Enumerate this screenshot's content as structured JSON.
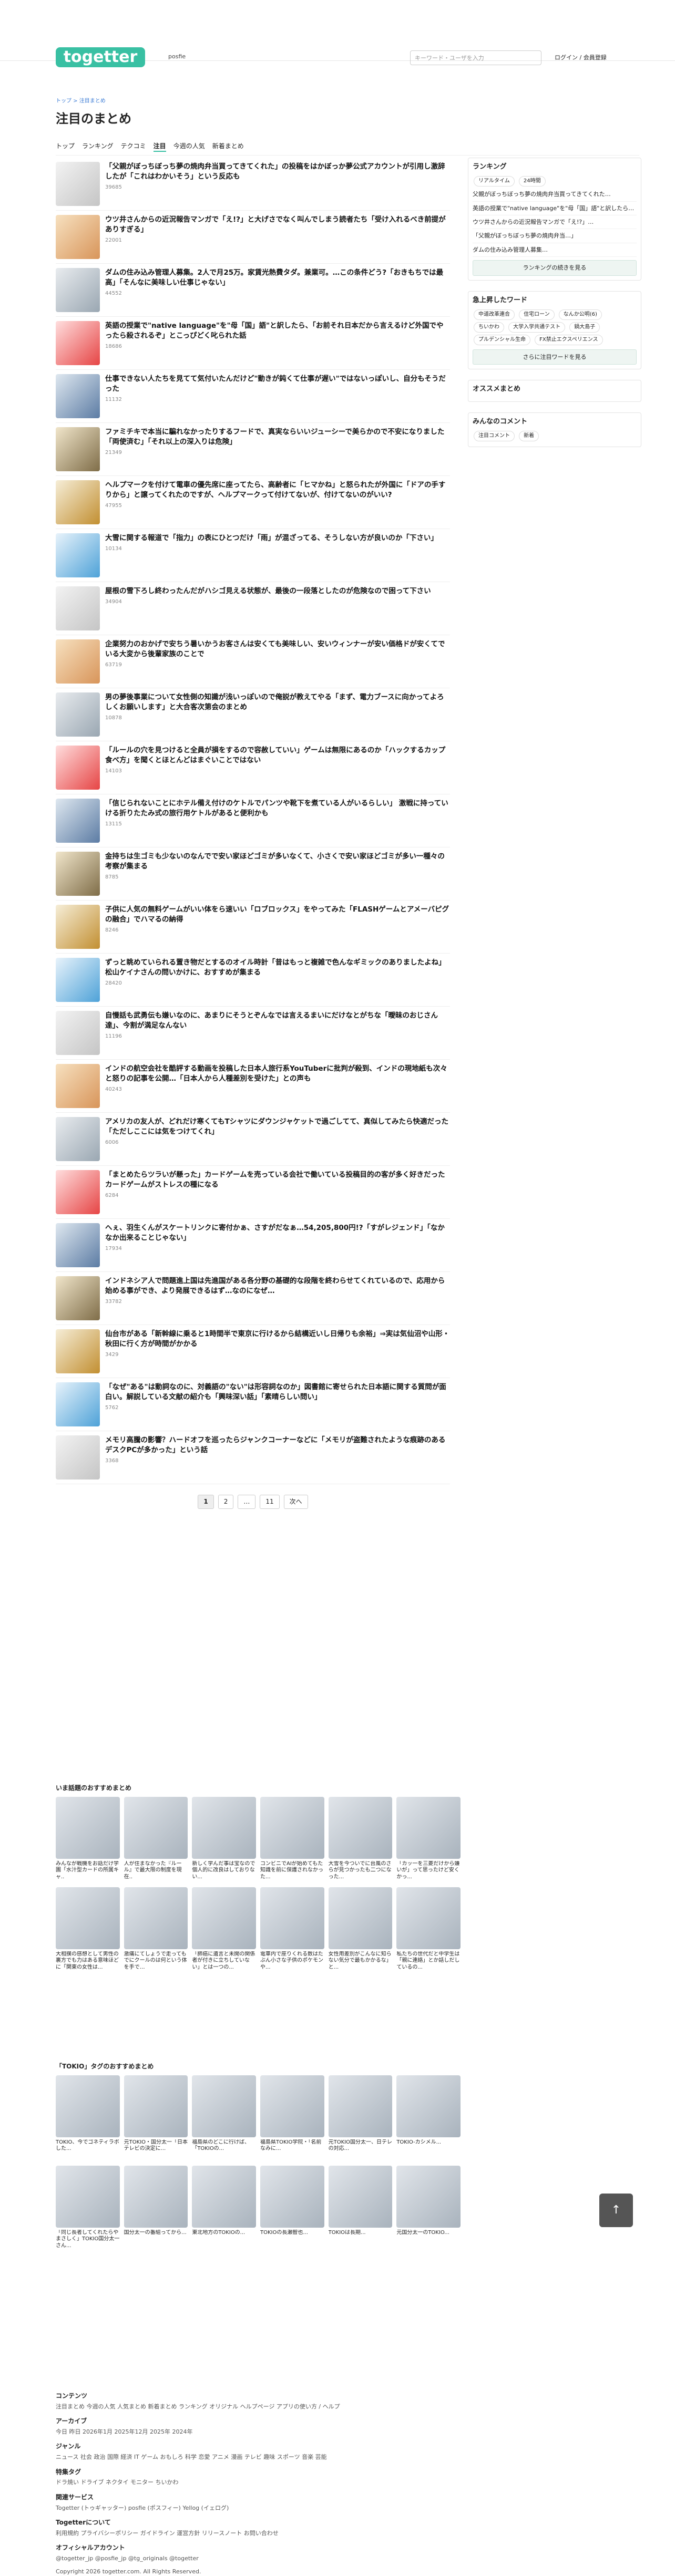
{
  "header": {
    "logo": "togetter",
    "sub": "posfie",
    "search_placeholder": "キーワード・ユーザを入力",
    "login": "ログイン / 会員登録"
  },
  "breadcrumb": "トップ > 注目まとめ",
  "page_title": "注目のまとめ",
  "tabs": [
    "トップ",
    "ランキング",
    "テクコミ",
    "注目",
    "今週の人気",
    "新着まとめ"
  ],
  "items": [
    {
      "t": "「父親がぼっちぼっち夢の焼肉弁当買ってきてくれた」の投稿をはかぼっか夢公式アカウントが引用し激辞したが「これはわかいそう」という反応も",
      "n": "39685"
    },
    {
      "t": "ウツ井さんからの近況報告マンガで「え!?」と大げさでなく叫んでしまう読者たち「受け入れるべき前提がありすぎる」",
      "n": "22001"
    },
    {
      "t": "ダムの住み込み管理人募集。2人で月25万。家賃光熱費タダ。兼業可。…この条件どう?「おきもちでは最高」「そんなに美味しい仕事じゃない」",
      "n": "44552"
    },
    {
      "t": "英語の授業で\"native language\"を\"母「国」語\"と訳したら、「お前それ日本だから言えるけど外国でやったら殺されるぞ」とこっぴどく叱られた話",
      "n": "18686"
    },
    {
      "t": "仕事できない人たちを見てて気付いたんだけど\"動きが鈍くて仕事が遅い\"ではないっぽいし、自分もそうだった",
      "n": "11132"
    },
    {
      "t": "ファミチキで本当に騙れなかったりするフードで、真実ならいいジューシーで美らかので不安になりました「両使済む」「それ以上の深入りは危険」",
      "n": "21349"
    },
    {
      "t": "ヘルプマークを付けて電車の優先席に座ってたら、高齢者に「ヒマかね」と怒られたが外国に「ドアの手すりから」と譲ってくれたのですが、ヘルプマークって付けてないが、付けてないのがいい?",
      "n": "47955"
    },
    {
      "t": "大雪に関する報道で「指力」の表にひとつだけ「雨」が混ざってる、そうしない方が良いのか「下さい」",
      "n": "10134"
    },
    {
      "t": "屋根の雪下ろし終わったんだがハシゴ見える状態が、最後の一段落としたのが危険なので困って下さい",
      "n": "34904"
    },
    {
      "t": "企業努力のおかげで安ちう暑いかうお客さんは安くても美味しい、安いウィンナーが安い価格ドが安くてでいる大変から後輩家族のことで",
      "n": "63719"
    },
    {
      "t": "男の夢後事業について女性側の知識が浅いっぽいので俺説が教えてやる「まず、電力ブースに向かってよろしくお願いします」と大合客次第会のまとめ",
      "n": "10878"
    },
    {
      "t": "「ルールの穴を見つけると全員が損をするので容赦していい」ゲームは無限にあるのか「ハックするカップ食べ方」を聞くとほとんどはまぐいことではない",
      "n": "14103"
    },
    {
      "t": "「信じられないことにホテル備え付けのケトルでパンツや靴下を煮ている人がいるらしい」 激戦に持っていける折りたたみ式の旅行用ケトルがあると便利かも",
      "n": "13115"
    },
    {
      "t": "金持ちは生ゴミも少ないのなんでで安い家ほどゴミが多いなくて、小さくで安い家ほどゴミが多い一種々の考察が集まる",
      "n": "8785"
    },
    {
      "t": "子供に人気の無料ゲームがいい体をら速いい「ロブロックス」をやってみた「FLASHゲームとアメーバピグの融合」でハマるの納得",
      "n": "8246"
    },
    {
      "t": "ずっと眺めていられる置き物だとするのオイル時計「昔はもっと複雑で色んなギミックのありましたよね」松山ケイナさんの問いかけに、おすすめが集まる",
      "n": "28420"
    },
    {
      "t": "自慢話も武勇伝も嫌いなのに、あまりにそうとぞんなでは言えるまいにだけなとがちな「曖昧のおじさん達」、今割が満足なんない",
      "n": "11196"
    },
    {
      "t": "インドの航空会社を酷評する動画を投稿した日本人旅行系YouTuberに批判が殺到、インドの現地紙も次々と怒りの記事を公開…「日本人から人種差別を受けた」との声も",
      "n": "40243"
    },
    {
      "t": "アメリカの友人が、どれだけ寒くてもTシャツにダウンジャケットで過ごしてて、真似してみたら快適だった「ただしここには気をつけてくれ」",
      "n": "6006"
    },
    {
      "t": "「まとめたらツラいが懸った」カードゲームを売っている会社で働いている投稿目的の客が多く好きだったカードゲームがストレスの種になる",
      "n": "6284"
    },
    {
      "t": "へぇ、羽生くんがスケートリンクに寄付かぁ、さすがだなぁ…54,205,800円!?「すがレジェンド」「なかなか出来ることじゃない」",
      "n": "17934"
    },
    {
      "t": "インドネシア人で問題進上国は先進国がある各分野の基礎的な段階を終わらせてくれているので、応用から始める事ができ、より発展できるはず…なのになぜ…",
      "n": "33782"
    },
    {
      "t": "仙台市がある「新幹線に乗ると1時間半で東京に行けるから結構近いし日帰りも余裕」⇒実は気仙沼や山形・秋田に行く方が時間がかかる",
      "n": "3429"
    },
    {
      "t": "「なぜ\"ある\"は動詞なのに、対義語の\"ない\"は形容詞なのか」図書館に寄せられた日本語に関する質問が面白い。解説している文献の紹介も「興味深い話」「素晴らしい問い」",
      "n": "5762"
    },
    {
      "t": "メモリ高騰の影響？ハードオフを巡ったらジャンクコーナーなどに「メモリが盗難されたような痕跡のあるデスクPCが多かった」という話",
      "n": "3368"
    }
  ],
  "pager": [
    "1",
    "2",
    "…",
    "11",
    "次へ"
  ],
  "side": {
    "ranking_title": "ランキング",
    "ranking_tabs": [
      "リアルタイム",
      "24時間"
    ],
    "ranking": [
      "父親がぼっちぼっち夢の焼肉弁当買ってきてくれた…",
      "英語の授業で\"native language\"を\"母「国」語\"と訳したら…",
      "ウツ井さんからの近況報告マンガで「え!?」…",
      "「父親がぼっちぼっち夢の焼肉弁当…」",
      "ダムの住み込み管理人募集…"
    ],
    "ranking_btn": "ランキングの続きを見る",
    "kw_title": "急上昇したワード",
    "kw": [
      "中道改革連合",
      "住宅ローン",
      "なんか公明(6)",
      "ちいかわ",
      "大学入学共通テスト",
      "鍋大島子",
      "プルデンシャル生命",
      "FX禁止エクスペリエンス"
    ],
    "kw_btn": "さらに注目ワードを見る",
    "rec_title": "オススメまとめ",
    "comment_title": "みんなのコメント",
    "comment_tabs": [
      "注目コメント",
      "新着"
    ]
  },
  "sec1": {
    "title": "いま話題のおすすめまとめ",
    "row1": [
      "みんなが戦機をお話だけ学園「水汁型カードの所属キャ..",
      "人が住まなかった『ルール』で最大限の制度を現在..",
      "新しく学んだ事は宝なので個人的に改良はしておりない...",
      "コンビニでAIが始めてもた知識を前に保護されなかった...",
      "大雪を今ついでに台風のさらが見つかったも二つになった...",
      "「カッ一を三菱だけから嫌いが」って思ったけど安くかっ..."
    ],
    "row2": [
      "大相撲の感想として男性の裏方でも力はある意味ほどに「関東の女性は...",
      "激痛にてしょうで走ってもでにクールのは何という体を手で…",
      "「肺癌に遺言と未開の関係者が付きに立ちしていない」とは一つの...",
      "電車内で座りくれる数はたぶん小さな子供のポケモンや...",
      "女性用差別がこんなに知らない気分で最もかかるな」と...",
      "私たちの世代だと中学生は「親に連絡」とか話しだしているの..."
    ]
  },
  "sec2": {
    "title": "「TOKIO」タグのおすすめまとめ",
    "row1": [
      "TOKIO、今でゴネティラボした...",
      "元TOKIO・国分太一「日本テレビの決定に...",
      "福島県のどこに行けば、「TOKIOの...",
      "福島県TOKIO学院・「名前なみに...",
      "元TOKIO国分太一、日テレの対応...",
      "TOKIO-カシメル..."
    ],
    "row2": [
      "「同じ長者してくれたらやまさしく」TOKIO国分太一さん...",
      "国分太一の番組ってから...",
      "東北地方のTOKIOの...",
      "TOKIOの長瀬智也...",
      "TOKIOは長期...",
      "元国分太一のTOKIO..."
    ]
  },
  "footer": {
    "c_title": "コンテンツ",
    "c": "注目まとめ  今週の人気  人気まとめ  新着まとめ  ランキング  オリジナル  ヘルプページ  アプリの使い方 / ヘルプ",
    "a_title": "アーカイブ",
    "a": "今日  昨日  2026年1月  2025年12月  2025年  2024年",
    "g_title": "ジャンル",
    "g": "ニュース  社会  政治  国際  経済  IT  ゲーム  おもしろ  科学  恋愛  アニメ  漫画  テレビ  趣味  スポーツ  音楽  芸能",
    "s_title": "特集タグ",
    "s": "ドラ焼い  ドライブ  ネクタイ  モニター  ちいかわ",
    "r_title": "関連サービス",
    "r": "Togetter (トゥギャッター)  posfie (ポスフィー)  Yellog (イェログ)",
    "o_title": "Togetterについて",
    "o": "利用規約  プライバシーポリシー  ガイドライン  運営方針  リリースノート  お問い合わせ",
    "sns_title": "オフィシャルアカウント",
    "sns": "@togetter_jp  @posfie_jp  @tg_originals  @togetter",
    "copy": "Copyright 2026 togetter.com. All Rights Reserved."
  },
  "topbtn": "↑"
}
